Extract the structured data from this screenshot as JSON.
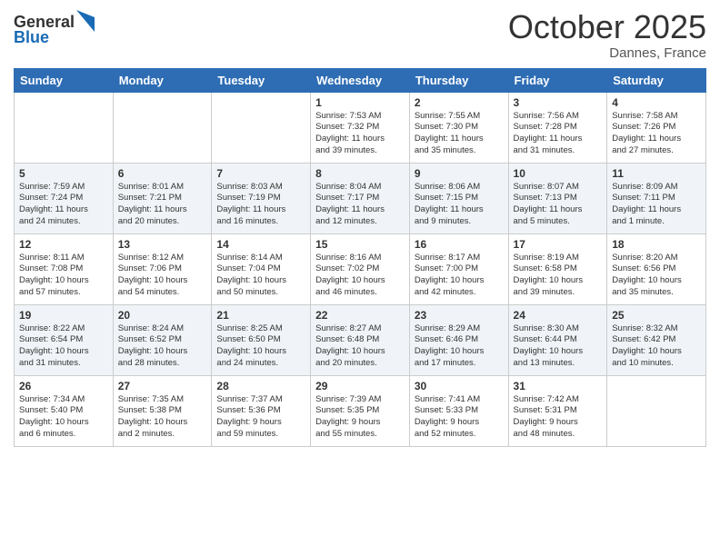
{
  "header": {
    "logo_line1": "General",
    "logo_line2": "Blue",
    "month": "October 2025",
    "location": "Dannes, France"
  },
  "days_of_week": [
    "Sunday",
    "Monday",
    "Tuesday",
    "Wednesday",
    "Thursday",
    "Friday",
    "Saturday"
  ],
  "weeks": [
    [
      {
        "day": "",
        "info": ""
      },
      {
        "day": "",
        "info": ""
      },
      {
        "day": "",
        "info": ""
      },
      {
        "day": "1",
        "info": "Sunrise: 7:53 AM\nSunset: 7:32 PM\nDaylight: 11 hours\nand 39 minutes."
      },
      {
        "day": "2",
        "info": "Sunrise: 7:55 AM\nSunset: 7:30 PM\nDaylight: 11 hours\nand 35 minutes."
      },
      {
        "day": "3",
        "info": "Sunrise: 7:56 AM\nSunset: 7:28 PM\nDaylight: 11 hours\nand 31 minutes."
      },
      {
        "day": "4",
        "info": "Sunrise: 7:58 AM\nSunset: 7:26 PM\nDaylight: 11 hours\nand 27 minutes."
      }
    ],
    [
      {
        "day": "5",
        "info": "Sunrise: 7:59 AM\nSunset: 7:24 PM\nDaylight: 11 hours\nand 24 minutes."
      },
      {
        "day": "6",
        "info": "Sunrise: 8:01 AM\nSunset: 7:21 PM\nDaylight: 11 hours\nand 20 minutes."
      },
      {
        "day": "7",
        "info": "Sunrise: 8:03 AM\nSunset: 7:19 PM\nDaylight: 11 hours\nand 16 minutes."
      },
      {
        "day": "8",
        "info": "Sunrise: 8:04 AM\nSunset: 7:17 PM\nDaylight: 11 hours\nand 12 minutes."
      },
      {
        "day": "9",
        "info": "Sunrise: 8:06 AM\nSunset: 7:15 PM\nDaylight: 11 hours\nand 9 minutes."
      },
      {
        "day": "10",
        "info": "Sunrise: 8:07 AM\nSunset: 7:13 PM\nDaylight: 11 hours\nand 5 minutes."
      },
      {
        "day": "11",
        "info": "Sunrise: 8:09 AM\nSunset: 7:11 PM\nDaylight: 11 hours\nand 1 minute."
      }
    ],
    [
      {
        "day": "12",
        "info": "Sunrise: 8:11 AM\nSunset: 7:08 PM\nDaylight: 10 hours\nand 57 minutes."
      },
      {
        "day": "13",
        "info": "Sunrise: 8:12 AM\nSunset: 7:06 PM\nDaylight: 10 hours\nand 54 minutes."
      },
      {
        "day": "14",
        "info": "Sunrise: 8:14 AM\nSunset: 7:04 PM\nDaylight: 10 hours\nand 50 minutes."
      },
      {
        "day": "15",
        "info": "Sunrise: 8:16 AM\nSunset: 7:02 PM\nDaylight: 10 hours\nand 46 minutes."
      },
      {
        "day": "16",
        "info": "Sunrise: 8:17 AM\nSunset: 7:00 PM\nDaylight: 10 hours\nand 42 minutes."
      },
      {
        "day": "17",
        "info": "Sunrise: 8:19 AM\nSunset: 6:58 PM\nDaylight: 10 hours\nand 39 minutes."
      },
      {
        "day": "18",
        "info": "Sunrise: 8:20 AM\nSunset: 6:56 PM\nDaylight: 10 hours\nand 35 minutes."
      }
    ],
    [
      {
        "day": "19",
        "info": "Sunrise: 8:22 AM\nSunset: 6:54 PM\nDaylight: 10 hours\nand 31 minutes."
      },
      {
        "day": "20",
        "info": "Sunrise: 8:24 AM\nSunset: 6:52 PM\nDaylight: 10 hours\nand 28 minutes."
      },
      {
        "day": "21",
        "info": "Sunrise: 8:25 AM\nSunset: 6:50 PM\nDaylight: 10 hours\nand 24 minutes."
      },
      {
        "day": "22",
        "info": "Sunrise: 8:27 AM\nSunset: 6:48 PM\nDaylight: 10 hours\nand 20 minutes."
      },
      {
        "day": "23",
        "info": "Sunrise: 8:29 AM\nSunset: 6:46 PM\nDaylight: 10 hours\nand 17 minutes."
      },
      {
        "day": "24",
        "info": "Sunrise: 8:30 AM\nSunset: 6:44 PM\nDaylight: 10 hours\nand 13 minutes."
      },
      {
        "day": "25",
        "info": "Sunrise: 8:32 AM\nSunset: 6:42 PM\nDaylight: 10 hours\nand 10 minutes."
      }
    ],
    [
      {
        "day": "26",
        "info": "Sunrise: 7:34 AM\nSunset: 5:40 PM\nDaylight: 10 hours\nand 6 minutes."
      },
      {
        "day": "27",
        "info": "Sunrise: 7:35 AM\nSunset: 5:38 PM\nDaylight: 10 hours\nand 2 minutes."
      },
      {
        "day": "28",
        "info": "Sunrise: 7:37 AM\nSunset: 5:36 PM\nDaylight: 9 hours\nand 59 minutes."
      },
      {
        "day": "29",
        "info": "Sunrise: 7:39 AM\nSunset: 5:35 PM\nDaylight: 9 hours\nand 55 minutes."
      },
      {
        "day": "30",
        "info": "Sunrise: 7:41 AM\nSunset: 5:33 PM\nDaylight: 9 hours\nand 52 minutes."
      },
      {
        "day": "31",
        "info": "Sunrise: 7:42 AM\nSunset: 5:31 PM\nDaylight: 9 hours\nand 48 minutes."
      },
      {
        "day": "",
        "info": ""
      }
    ]
  ]
}
